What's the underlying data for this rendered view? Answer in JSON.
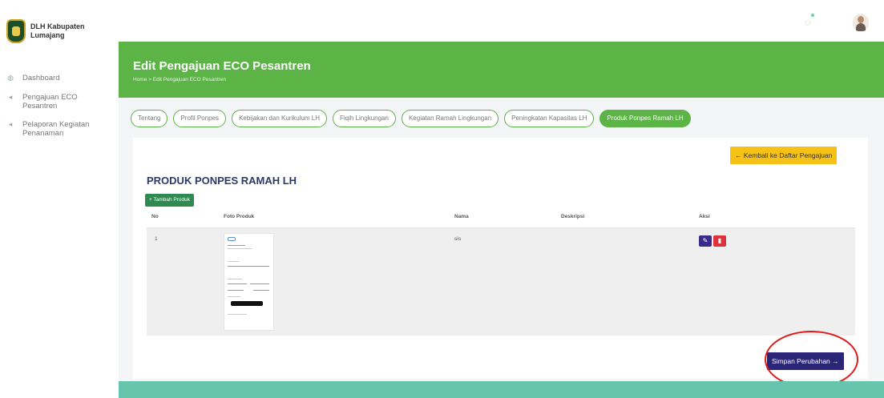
{
  "sidebar": {
    "brand": "DLH Kabupaten Lumajang",
    "items": [
      {
        "label": "Dashboard",
        "icon": "dashboard-icon"
      },
      {
        "label": "Pengajuan ECO Pesantren",
        "icon": "send-icon"
      },
      {
        "label": "Pelaporan Kegiatan Penanaman",
        "icon": "send-icon"
      }
    ]
  },
  "topbar": {
    "bell_icon": "bell-icon",
    "avatar": "user-avatar"
  },
  "header": {
    "title": "Edit Pengajuan ECO Pesantren",
    "breadcrumb": "Home  >  Edit Pengajuan ECO Pesantren"
  },
  "tabs": [
    {
      "label": "Tentang"
    },
    {
      "label": "Profil Ponpes"
    },
    {
      "label": "Kebijakan dan Kurikulum LH"
    },
    {
      "label": "Fiqih Lingkungan"
    },
    {
      "label": "Kegiatan Ramah Lingkungan"
    },
    {
      "label": "Peningkatan Kapasitas LH"
    },
    {
      "label": "Produk Ponpes Ramah LH",
      "active": true
    }
  ],
  "main": {
    "back_label": "← Kembali ke Daftar Pengajuan",
    "section_title": "PRODUK PONPES RAMAH LH",
    "add_label": "+ Tambah Produk",
    "table": {
      "headers": [
        "No",
        "Foto Produk",
        "Nama",
        "Deskripsi",
        "Aksi"
      ],
      "rows": [
        {
          "no": "1",
          "nama": "sis",
          "deskripsi": ""
        }
      ]
    },
    "save_label": "Simpan Perubahan →"
  },
  "colors": {
    "green": "#5cb346",
    "teal_footer": "#67c5ad",
    "navy_button": "#2b2578",
    "yellow_button": "#f5c116",
    "delete_red": "#e0323c",
    "annotation_red": "#e01b1b"
  }
}
